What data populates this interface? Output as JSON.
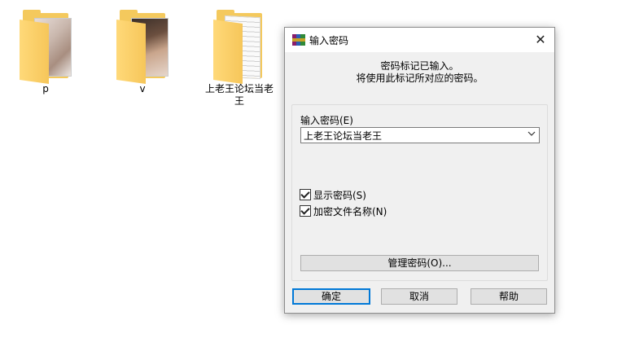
{
  "desktop": {
    "items": [
      {
        "label": "p"
      },
      {
        "label": "v"
      },
      {
        "label": "上老王论坛当老王"
      }
    ]
  },
  "dialog": {
    "title": "输入密码",
    "message_line1": "密码标记已输入。",
    "message_line2": "将使用此标记所对应的密码。",
    "password_label": "输入密码(E)",
    "password_value": "上老王论坛当老王",
    "show_password_label": "显示密码(S)",
    "encrypt_names_label": "加密文件名称(N)",
    "manage_label": "管理密码(O)...",
    "ok_label": "确定",
    "cancel_label": "取消",
    "help_label": "帮助",
    "close_symbol": "✕"
  },
  "icons": {
    "app": "winrar-icon",
    "close": "close-icon",
    "dropdown": "chevron-down-icon",
    "folder": "folder-icon"
  },
  "colors": {
    "accent": "#0078d7",
    "dialog_bg": "#f0f0f0",
    "folder": "#f4c95d"
  }
}
